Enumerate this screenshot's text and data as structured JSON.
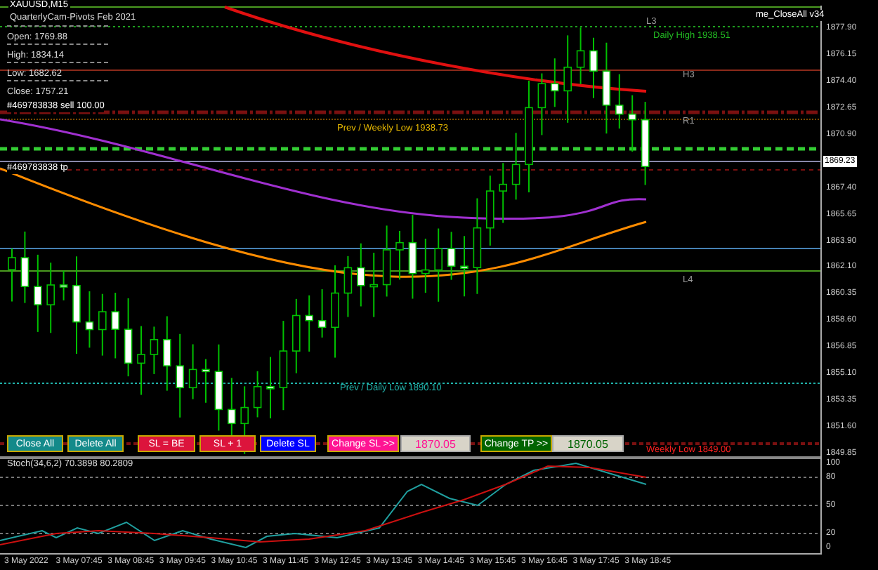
{
  "chart": {
    "symbol": "XAUUSD,M15",
    "expert": "me_CloseAll v34",
    "info_panel": {
      "title": "QuarterlyCam-Pivots Feb 2021",
      "lines": [
        "Open: 1769.88",
        "High: 1834.14",
        "Low: 1682.62",
        "Close: 1757.21"
      ]
    },
    "order_labels": [
      "#469783838 sell 100.00",
      "#469783838 tp"
    ],
    "level_labels": [
      {
        "text": "L3",
        "kind": "level"
      },
      {
        "text": "Daily High 1938.51",
        "kind": "pivot"
      },
      {
        "text": "H3",
        "kind": "level"
      },
      {
        "text": "R1",
        "kind": "level"
      },
      {
        "text": "Prev / Weekly Low 1938.73",
        "kind": "weekly"
      },
      {
        "text": "L4",
        "kind": "level"
      },
      {
        "text": "Prev / Daily Low 1890.10",
        "kind": "daily"
      },
      {
        "text": "Weekly Low 1849.00",
        "kind": "alert"
      }
    ],
    "price_axis": {
      "ticks": [
        {
          "label": "1877.90",
          "highlighted": false
        },
        {
          "label": "1876.15",
          "highlighted": false
        },
        {
          "label": "1874.40",
          "highlighted": false
        },
        {
          "label": "1872.65",
          "highlighted": false
        },
        {
          "label": "1870.90",
          "highlighted": false
        },
        {
          "label": "1869.23",
          "highlighted": true
        },
        {
          "label": "1867.40",
          "highlighted": false
        },
        {
          "label": "1865.65",
          "highlighted": false
        },
        {
          "label": "1863.90",
          "highlighted": false
        },
        {
          "label": "1862.10",
          "highlighted": false
        },
        {
          "label": "1860.35",
          "highlighted": false
        },
        {
          "label": "1858.60",
          "highlighted": false
        },
        {
          "label": "1856.85",
          "highlighted": false
        },
        {
          "label": "1855.10",
          "highlighted": false
        },
        {
          "label": "1853.35",
          "highlighted": false
        },
        {
          "label": "1851.60",
          "highlighted": false
        },
        {
          "label": "1849.85",
          "highlighted": false
        }
      ]
    },
    "controls": [
      {
        "kind": "button",
        "label": "Close All",
        "color": "#138a8a"
      },
      {
        "kind": "button",
        "label": "Delete All",
        "color": "#138a8a"
      },
      {
        "kind": "button",
        "label": "SL = BE",
        "color": "#dc143c"
      },
      {
        "kind": "button",
        "label": "SL + 1",
        "color": "#dc143c"
      },
      {
        "kind": "button",
        "label": "Delete SL",
        "color": "#0000ff"
      },
      {
        "kind": "button",
        "label": "Change SL >>",
        "color": "#ff1493"
      },
      {
        "kind": "field",
        "value": "1870.05",
        "color": "#ff1493"
      },
      {
        "kind": "button",
        "label": "Change TP >>",
        "color": "#006400"
      },
      {
        "kind": "field",
        "value": "1870.05",
        "color": "#006400"
      }
    ]
  },
  "stochastic": {
    "title": "Stoch(34,6,2) 70.3898 80.2809",
    "ticks": [
      "100",
      "80",
      "50",
      "20",
      "0"
    ]
  },
  "time_axis": [
    "3 May 2022",
    "3 May 07:45",
    "3 May 08:45",
    "3 May 09:45",
    "3 May 10:45",
    "3 May 11:45",
    "3 May 12:45",
    "3 May 13:45",
    "3 May 14:45",
    "3 May 15:45",
    "3 May 16:45",
    "3 May 17:45",
    "3 May 18:45"
  ]
}
